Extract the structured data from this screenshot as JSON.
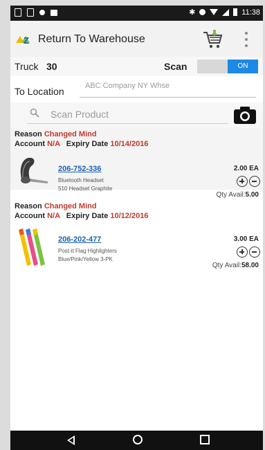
{
  "status_bar": {
    "time": "11:38"
  },
  "app_bar": {
    "title": "Return To Warehouse"
  },
  "truck": {
    "label": "Truck",
    "value": "30",
    "scan_label": "Scan",
    "scan_toggle": "ON"
  },
  "location": {
    "label": "To Location",
    "value": "ABC Company NY Whse"
  },
  "search": {
    "placeholder": "Scan Product"
  },
  "items": [
    {
      "reason_label": "Reason",
      "reason": "Changed Mind",
      "account_label": "Account",
      "account": "N/A",
      "expiry_label": "Expiry Date",
      "expiry": "10/14/2016",
      "sku": "206-752-336",
      "desc1": "Bluetooth Headset",
      "desc2": "510 Headset Graphite",
      "qty": "2.00 EA",
      "avail_label": "Qty Avail:",
      "avail": "5.00"
    },
    {
      "reason_label": "Reason",
      "reason": "Changed Mind",
      "account_label": "Account",
      "account": "N/A",
      "expiry_label": "Expiry Date",
      "expiry": "10/12/2016",
      "sku": "206-202-477",
      "desc1": "Post-it Flag Highlighters",
      "desc2": "Blue/Pink/Yellow 3-PK",
      "qty": "3.00 EA",
      "avail_label": "Qty Avail:",
      "avail": "58.00"
    }
  ],
  "colors": {
    "accent": "#1e88e5",
    "reason": "#c0392b",
    "link": "#1a5fb4"
  },
  "icons": [
    "cart-icon",
    "overflow-menu-icon",
    "search-icon",
    "camera-icon",
    "plus-circle-icon",
    "minus-circle-icon"
  ]
}
